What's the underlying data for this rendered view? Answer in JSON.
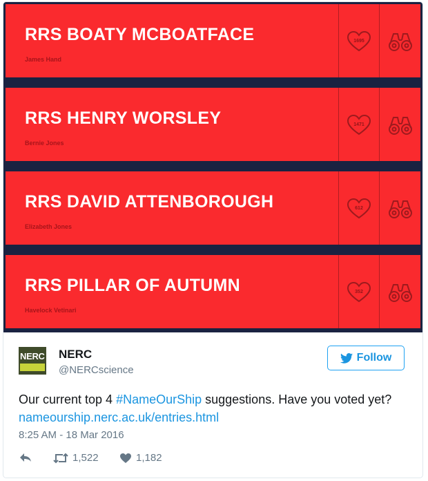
{
  "entries": [
    {
      "name": "RRS BOATY MCBOATFACE",
      "author": "James Hand",
      "votes": "1695"
    },
    {
      "name": "RRS HENRY WORSLEY",
      "author": "Bernie Jones",
      "votes": "1471"
    },
    {
      "name": "RRS DAVID ATTENBOROUGH",
      "author": "Elizabeth Jones",
      "votes": "612"
    },
    {
      "name": "RRS PILLAR OF AUTUMN",
      "author": "Havelock Vetinari",
      "votes": "352"
    }
  ],
  "tweet": {
    "author_name": "NERC",
    "handle": "@NERCscience",
    "logo_text": "NERC",
    "follow_label": "Follow",
    "text_before_hashtag": "Our current top 4 ",
    "hashtag": "#NameOurShip",
    "text_after_hashtag": " suggestions. Have you voted yet? ",
    "link": "nameourship.nerc.ac.uk/entries.html",
    "timestamp": "8:25 AM - 18 Mar 2016",
    "retweets": "1,522",
    "likes": "1,182"
  },
  "colors": {
    "entry_bg": "#fa2a2e",
    "media_bg": "#1a2241",
    "link": "#1b95e0"
  },
  "icons": [
    "heart-icon",
    "binoculars-icon",
    "reply-icon",
    "retweet-icon",
    "like-icon",
    "twitter-bird-icon"
  ]
}
